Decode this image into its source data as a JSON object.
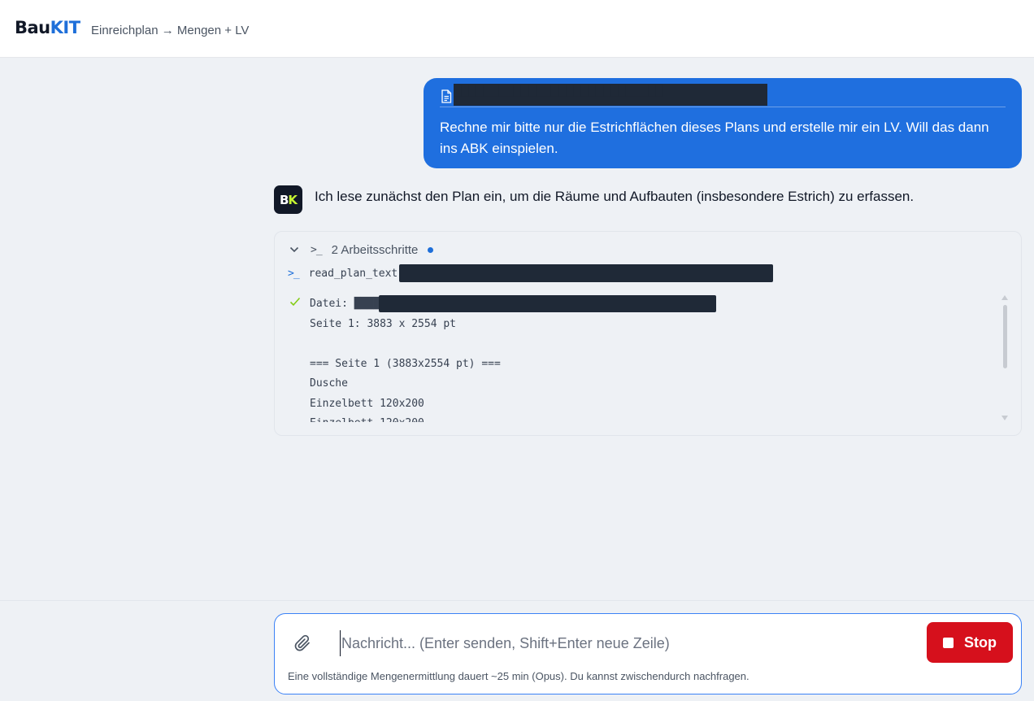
{
  "header": {
    "logo_part1": "Bau",
    "logo_part2": "KIT",
    "breadcrumb": "Einreichplan → Mengen + LV"
  },
  "user_message": {
    "file_icon": "document-icon",
    "file_name_redacted": "████████████████████████████",
    "text": "Rechne mir bitte nur die Estrichflächen dieses Plans und erstelle mir ein LV. Will das dann ins ABK einspielen."
  },
  "assistant": {
    "avatar_b": "B",
    "avatar_k": "K",
    "text": "Ich lese zunächst den Plan ein, um die Räume und Aufbauten (insbesondere Estrich) zu erfassen."
  },
  "steps": {
    "title": "2 Arbeitsschritte",
    "prompt_symbol": ">_",
    "status_dot_color": "#1e6fd9",
    "tool_name": "read_plan_text",
    "output_lines": [
      "Datei: ██████████████████████████████████████████████████en: 1",
      "Seite 1: 3883 x 2554 pt",
      "",
      "=== Seite 1 (3883x2554 pt) ===",
      "Dusche",
      "Einzelbett 120x200",
      "Einzelbett 120x200"
    ]
  },
  "composer": {
    "placeholder": "Nachricht... (Enter senden, Shift+Enter neue Zeile)",
    "stop_label": "Stop",
    "hint": "Eine vollständige Mengenermittlung dauert ~25 min (Opus). Du kannst zwischendurch nachfragen."
  },
  "colors": {
    "accent": "#1f6fdf",
    "stop": "#d6101c",
    "background": "#eef1f5"
  }
}
